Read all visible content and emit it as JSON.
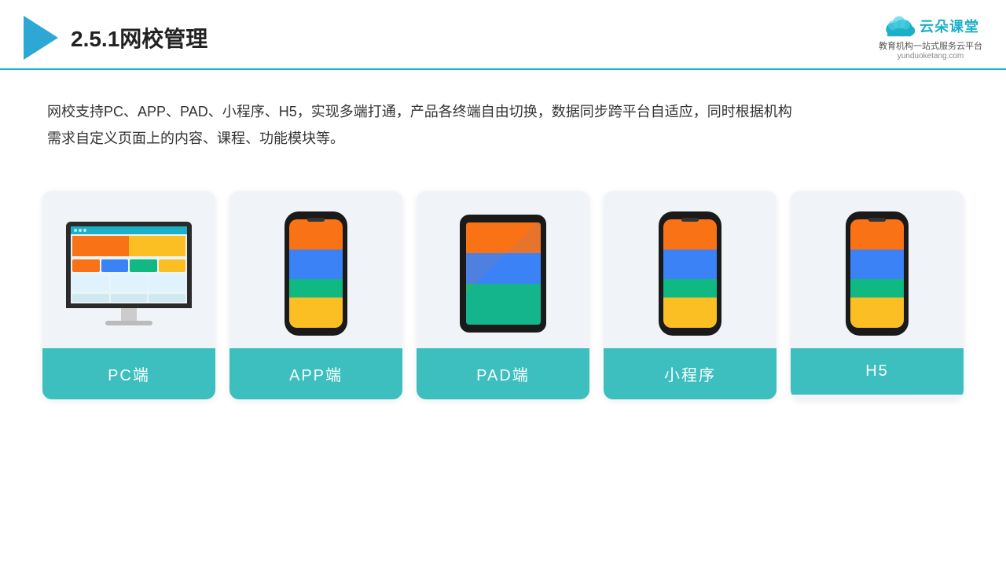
{
  "header": {
    "title": "2.5.1网校管理",
    "logo_main": "云朵课堂",
    "logo_sub": "教育机构一站\n式服务云平台",
    "logo_url": "yunduoketang.com"
  },
  "description": {
    "text": "网校支持PC、APP、PAD、小程序、H5，实现多端打通，产品各终端自由切换，数据同步跨平台自适应，同时根据机构需求自定义页面上的内容、课程、功能模块等。"
  },
  "cards": [
    {
      "id": "pc",
      "label": "PC端",
      "type": "monitor"
    },
    {
      "id": "app",
      "label": "APP端",
      "type": "phone"
    },
    {
      "id": "pad",
      "label": "PAD端",
      "type": "tablet"
    },
    {
      "id": "miniprogram",
      "label": "小程序",
      "type": "phone"
    },
    {
      "id": "h5",
      "label": "H5",
      "type": "phone"
    }
  ],
  "colors": {
    "accent": "#1ab0c8",
    "card_label_bg": "#3dbfbf",
    "text_dark": "#222",
    "text_body": "#333"
  }
}
